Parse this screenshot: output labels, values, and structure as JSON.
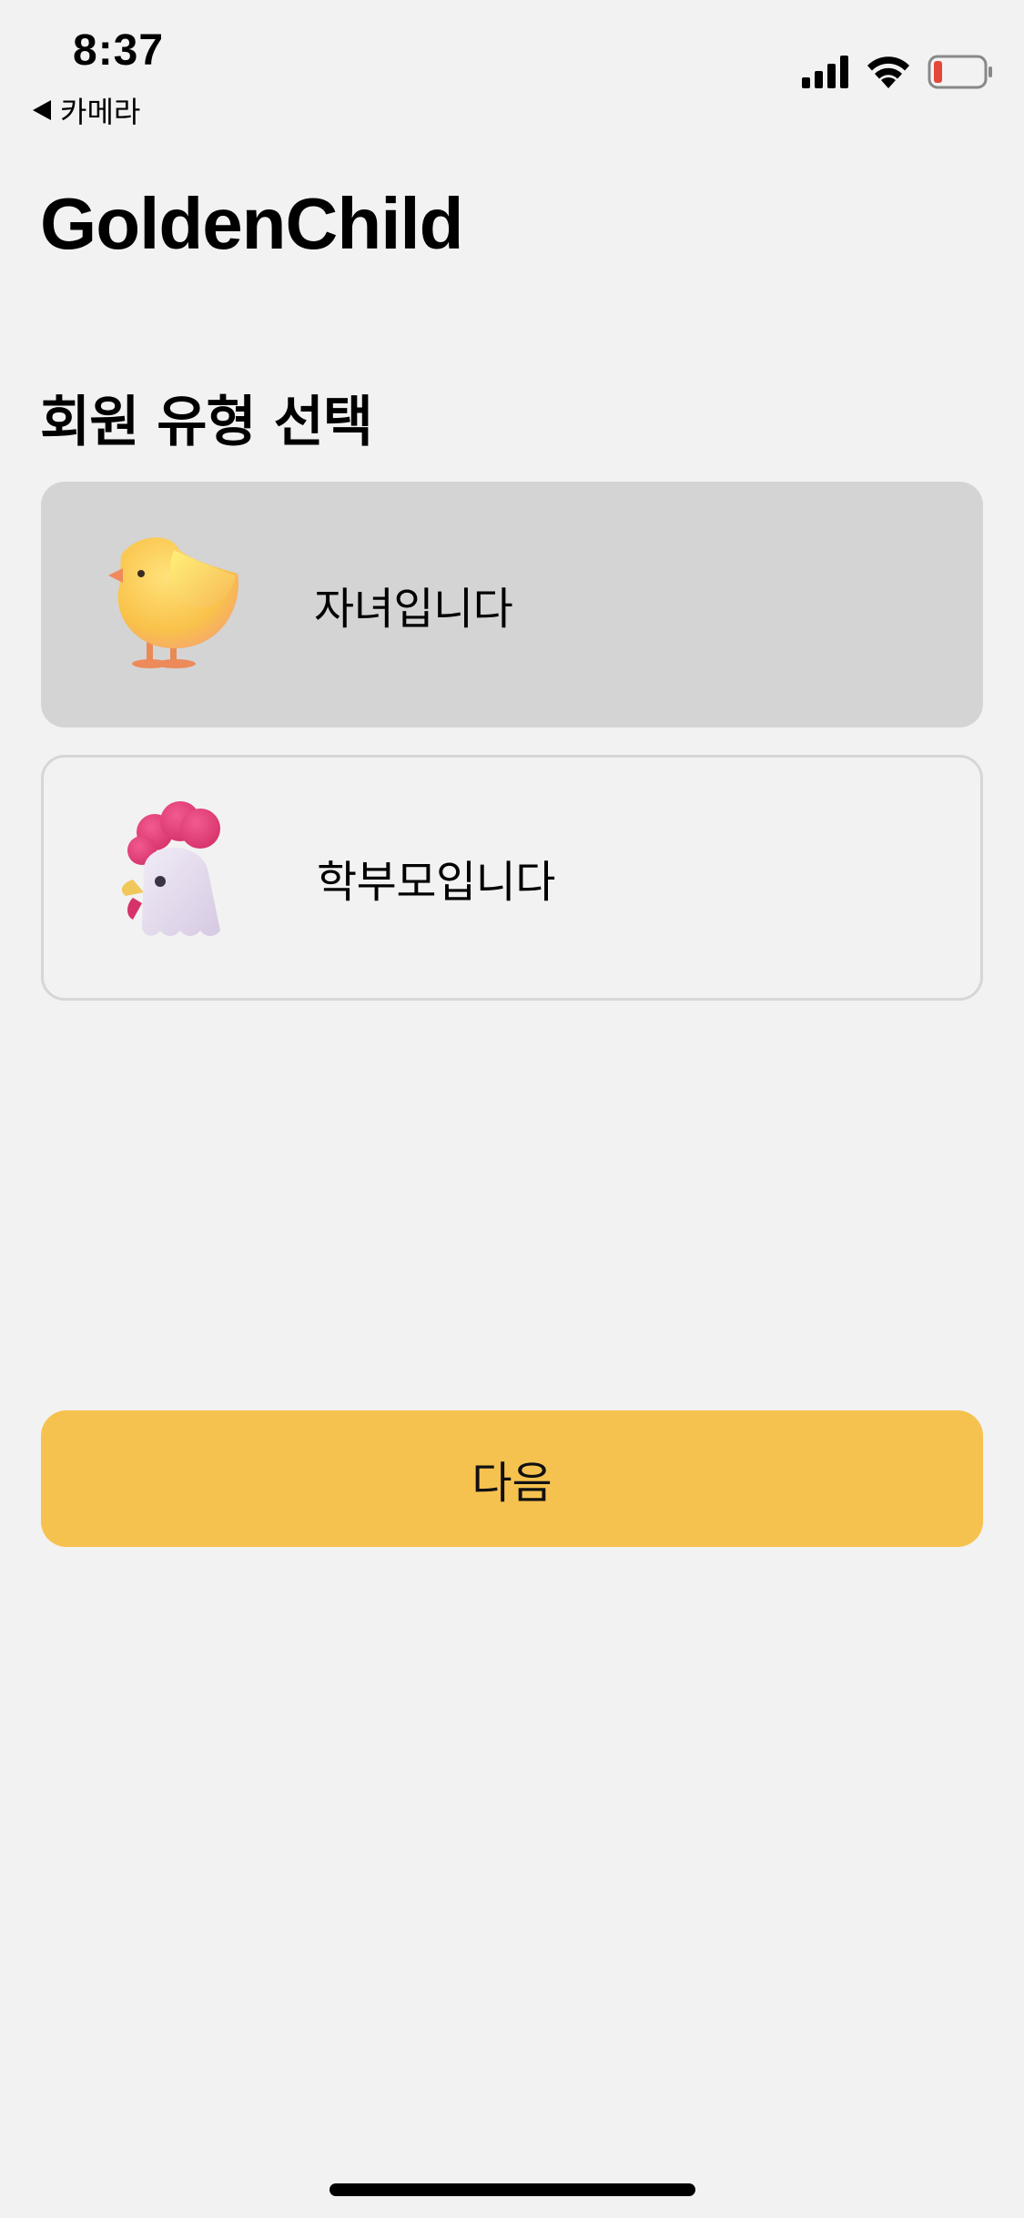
{
  "status_bar": {
    "time": "8:37",
    "back_label": "카메라",
    "icons": [
      "signal-icon",
      "wifi-icon",
      "battery-icon"
    ],
    "battery_color": "#e5463a"
  },
  "app": {
    "title": "GoldenChild"
  },
  "member_type": {
    "title": "회원 유형 선택",
    "options": [
      {
        "label": "자녀입니다",
        "icon": "chick-icon",
        "selected": true
      },
      {
        "label": "학부모입니다",
        "icon": "rooster-icon",
        "selected": false
      }
    ]
  },
  "actions": {
    "next_label": "다음"
  },
  "colors": {
    "background": "#f2f2f2",
    "selected_card": "#d4d4d4",
    "accent": "#f6c24f"
  }
}
